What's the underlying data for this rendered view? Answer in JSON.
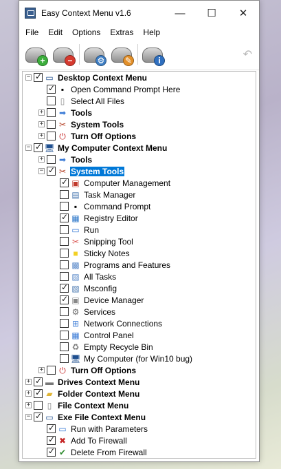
{
  "window": {
    "title": "Easy Context Menu v1.6",
    "minimize": "—",
    "maximize": "☐",
    "close": "✕"
  },
  "menu": [
    "File",
    "Edit",
    "Options",
    "Extras",
    "Help"
  ],
  "toolbar": {
    "undo": "↶"
  },
  "tree": [
    {
      "label": "Desktop Context Menu",
      "level": 0,
      "expander": "−",
      "checked": true,
      "bold": true,
      "icon": "desktop-icon"
    },
    {
      "label": "Open Command Prompt Here",
      "level": 1,
      "expander": "",
      "checked": true,
      "bold": false,
      "icon": "cmd-icon"
    },
    {
      "label": "Select All Files",
      "level": 1,
      "expander": "",
      "checked": false,
      "bold": false,
      "icon": "file-icon"
    },
    {
      "label": "Tools",
      "level": 1,
      "expander": "+",
      "checked": false,
      "bold": true,
      "icon": "arrow-icon"
    },
    {
      "label": "System Tools",
      "level": 1,
      "expander": "+",
      "checked": false,
      "bold": true,
      "icon": "tools-icon"
    },
    {
      "label": "Turn Off Options",
      "level": 1,
      "expander": "+",
      "checked": false,
      "bold": true,
      "icon": "power-icon"
    },
    {
      "label": "My Computer Context Menu",
      "level": 0,
      "expander": "−",
      "checked": true,
      "bold": true,
      "icon": "computer-icon"
    },
    {
      "label": "Tools",
      "level": 1,
      "expander": "+",
      "checked": false,
      "bold": true,
      "icon": "arrow-icon"
    },
    {
      "label": "System Tools",
      "level": 1,
      "expander": "−",
      "checked": true,
      "bold": true,
      "icon": "tools-icon",
      "selected": true
    },
    {
      "label": "Computer Management",
      "level": 2,
      "expander": "",
      "checked": true,
      "bold": false,
      "icon": "management-icon"
    },
    {
      "label": "Task Manager",
      "level": 2,
      "expander": "",
      "checked": false,
      "bold": false,
      "icon": "taskmgr-icon"
    },
    {
      "label": "Command Prompt",
      "level": 2,
      "expander": "",
      "checked": false,
      "bold": false,
      "icon": "cmd-icon"
    },
    {
      "label": "Registry Editor",
      "level": 2,
      "expander": "",
      "checked": true,
      "bold": false,
      "icon": "registry-icon"
    },
    {
      "label": "Run",
      "level": 2,
      "expander": "",
      "checked": false,
      "bold": false,
      "icon": "run-icon"
    },
    {
      "label": "Snipping Tool",
      "level": 2,
      "expander": "",
      "checked": false,
      "bold": false,
      "icon": "scissors-icon"
    },
    {
      "label": "Sticky Notes",
      "level": 2,
      "expander": "",
      "checked": false,
      "bold": false,
      "icon": "note-icon"
    },
    {
      "label": "Programs and Features",
      "level": 2,
      "expander": "",
      "checked": false,
      "bold": false,
      "icon": "programs-icon"
    },
    {
      "label": "All Tasks",
      "level": 2,
      "expander": "",
      "checked": false,
      "bold": false,
      "icon": "tasks-icon"
    },
    {
      "label": "Msconfig",
      "level": 2,
      "expander": "",
      "checked": true,
      "bold": false,
      "icon": "msconfig-icon"
    },
    {
      "label": "Device Manager",
      "level": 2,
      "expander": "",
      "checked": true,
      "bold": false,
      "icon": "device-icon"
    },
    {
      "label": "Services",
      "level": 2,
      "expander": "",
      "checked": false,
      "bold": false,
      "icon": "gear-icon"
    },
    {
      "label": "Network Connections",
      "level": 2,
      "expander": "",
      "checked": false,
      "bold": false,
      "icon": "network-icon"
    },
    {
      "label": "Control Panel",
      "level": 2,
      "expander": "",
      "checked": false,
      "bold": false,
      "icon": "control-panel-icon"
    },
    {
      "label": "Empty Recycle Bin",
      "level": 2,
      "expander": "",
      "checked": false,
      "bold": false,
      "icon": "recycle-bin-icon"
    },
    {
      "label": "My Computer (for Win10 bug)",
      "level": 2,
      "expander": "",
      "checked": false,
      "bold": false,
      "icon": "computer-icon"
    },
    {
      "label": "Turn Off Options",
      "level": 1,
      "expander": "+",
      "checked": false,
      "bold": true,
      "icon": "power-icon"
    },
    {
      "label": "Drives Context Menu",
      "level": 0,
      "expander": "+",
      "checked": true,
      "bold": true,
      "icon": "drive-icon"
    },
    {
      "label": "Folder Context Menu",
      "level": 0,
      "expander": "+",
      "checked": true,
      "bold": true,
      "icon": "folder-icon"
    },
    {
      "label": "File Context Menu",
      "level": 0,
      "expander": "+",
      "checked": false,
      "bold": true,
      "icon": "file-icon"
    },
    {
      "label": "Exe File Context Menu",
      "level": 0,
      "expander": "−",
      "checked": true,
      "bold": true,
      "icon": "exe-icon"
    },
    {
      "label": "Run with Parameters",
      "level": 1,
      "expander": "",
      "checked": true,
      "bold": false,
      "icon": "run-icon"
    },
    {
      "label": "Add To Firewall",
      "level": 1,
      "expander": "",
      "checked": true,
      "bold": false,
      "icon": "firewall-add-icon"
    },
    {
      "label": "Delete From Firewall",
      "level": 1,
      "expander": "",
      "checked": true,
      "bold": false,
      "icon": "firewall-delete-icon"
    }
  ]
}
